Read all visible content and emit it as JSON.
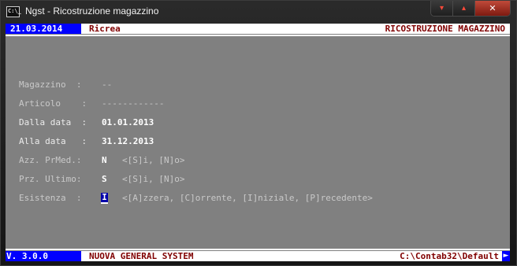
{
  "window": {
    "title": "Ngst - Ricostruzione magazzino",
    "icon_text": "C:\\_",
    "buttons": [
      "minimize",
      "maximize",
      "close"
    ]
  },
  "header": {
    "date": "21.03.2014",
    "operation": "Ricrea",
    "program_name": "RICOSTRUZIONE MAGAZZINO"
  },
  "form": {
    "magazzino": {
      "label": "Magazzino  :",
      "value": "--"
    },
    "articolo": {
      "label": "Articolo    :",
      "value": "------------"
    },
    "dalla_data": {
      "label": "Dalla data  :",
      "value": "01.01.2013"
    },
    "alla_data": {
      "label": "Alla data   :",
      "value": "31.12.2013"
    },
    "azz_prmed": {
      "label": "Azz. PrMed.:",
      "value": "N",
      "hint": "<[S]i, [N]o>"
    },
    "prz_ultimo": {
      "label": "Prz. Ultimo:",
      "value": "S",
      "hint": "<[S]i, [N]o>"
    },
    "esistenza": {
      "label": "Esistenza  :",
      "value": "I",
      "hint": "<[A]zzera, [C]orrente, [I]niziale, [P]recedente>"
    }
  },
  "footer": {
    "version": "V. 3.0.0",
    "system_name": "NUOVA GENERAL SYSTEM",
    "path": "C:\\Contab32\\Default",
    "scroll_arrow": "►"
  },
  "colors": {
    "console_bg": "#808080",
    "bar_blue": "#0000ff",
    "bar_text": "#800000",
    "bar_white": "#ffffff"
  }
}
